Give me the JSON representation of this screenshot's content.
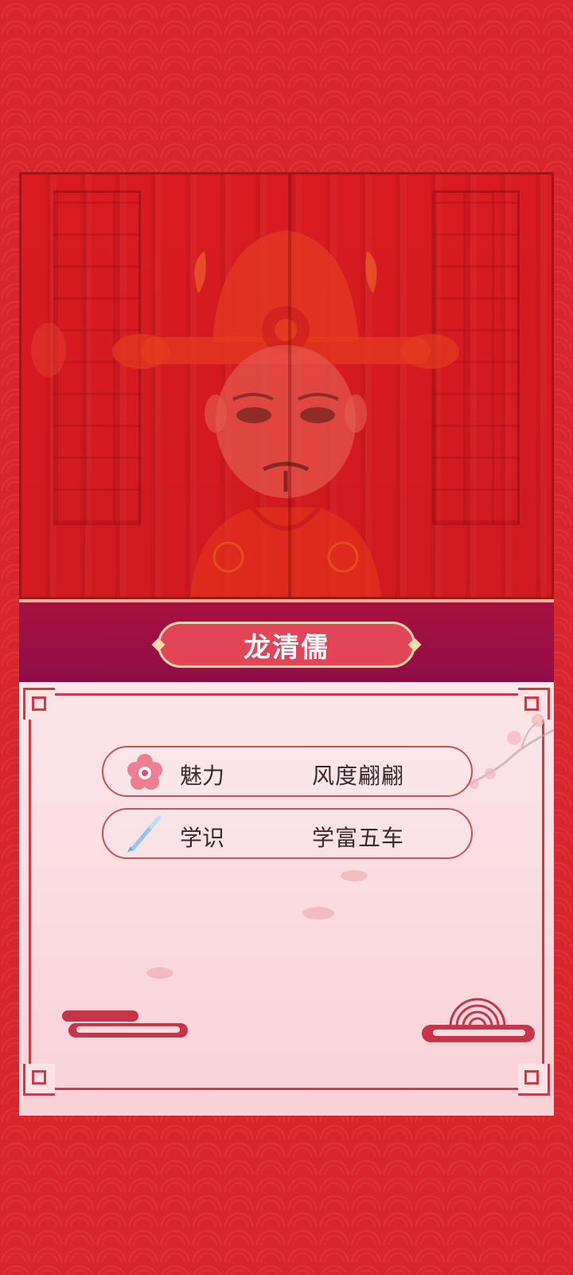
{
  "character": {
    "name": "龙清儒"
  },
  "stats": [
    {
      "label": "魅力",
      "value": "风度翩翩",
      "icon": "plum-blossom-icon"
    },
    {
      "label": "学识",
      "value": "学富五车",
      "icon": "writing-brush-icon"
    }
  ],
  "colors": {
    "background_red": "#d8262c",
    "banner_magenta": "#8f0c47",
    "name_plate": "#e04657",
    "card_pink": "#fbe6e9",
    "frame_red": "#d23944",
    "text_dark": "#3a2a2e"
  }
}
